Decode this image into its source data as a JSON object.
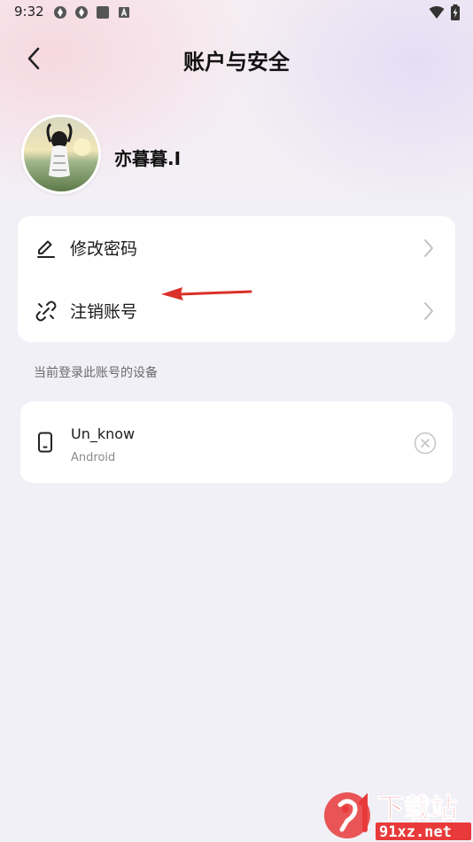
{
  "status_bar": {
    "time": "9:32",
    "left_icons": [
      "sync-icon",
      "sync-icon",
      "app-square-icon",
      "a-box-icon"
    ],
    "right_icons": [
      "wifi-icon",
      "battery-charging-icon"
    ]
  },
  "header": {
    "back_icon": "chevron-left-icon",
    "title": "账户与安全"
  },
  "profile": {
    "username": "亦暮暮.I"
  },
  "menu": {
    "items": [
      {
        "label": "修改密码",
        "icon": "pencil-icon"
      },
      {
        "label": "注销账号",
        "icon": "broken-link-icon"
      }
    ]
  },
  "devices": {
    "caption": "当前登录此账号的设备",
    "items": [
      {
        "name": "Un_know",
        "os": "Android",
        "icon": "phone-icon"
      }
    ]
  },
  "annotation": {
    "color": "#d9302a"
  },
  "watermark": {
    "brand_color": "#e83a3a"
  }
}
